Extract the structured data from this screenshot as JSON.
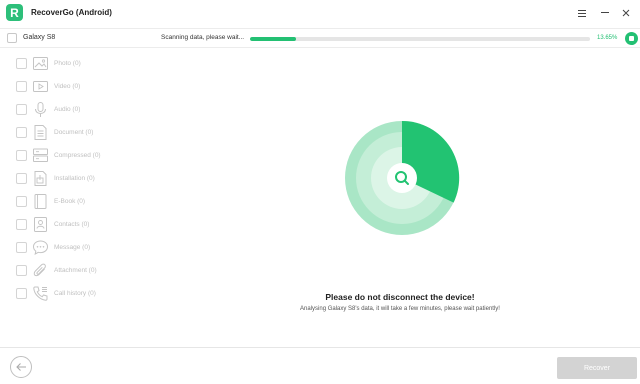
{
  "app": {
    "title": "RecoverGo (Android)",
    "logo_letter": "R",
    "brand_color": "#2dbf7a",
    "menu_icon": "hamburger-menu-icon",
    "minimize_icon": "minimize-icon",
    "close_icon": "close-icon"
  },
  "device": {
    "name": "Galaxy S8",
    "checked": false
  },
  "scan": {
    "status_text": "Scanning data, please wait...",
    "progress_percent": 13.65,
    "progress_label": "13.65%",
    "accent_color": "#23c073",
    "stop_icon": "stop-icon"
  },
  "categories": [
    {
      "icon": "photo-icon",
      "label": "Photo (0)"
    },
    {
      "icon": "video-icon",
      "label": "Video (0)"
    },
    {
      "icon": "audio-icon",
      "label": "Audio (0)"
    },
    {
      "icon": "document-icon",
      "label": "Document (0)"
    },
    {
      "icon": "compressed-icon",
      "label": "Compressed (0)"
    },
    {
      "icon": "installation-icon",
      "label": "Installation (0)"
    },
    {
      "icon": "ebook-icon",
      "label": "E-Book (0)"
    },
    {
      "icon": "contacts-icon",
      "label": "Contacts (0)"
    },
    {
      "icon": "message-icon",
      "label": "Message (0)"
    },
    {
      "icon": "attachment-icon",
      "label": "Attachment (0)"
    },
    {
      "icon": "call-history-icon",
      "label": "Call history (0)"
    }
  ],
  "center": {
    "radar_icon": "search-icon",
    "message_title": "Please do not disconnect the device!",
    "message_sub": "Analysing Galaxy S8's data, it will take a few minutes, please wait patiently!"
  },
  "footer": {
    "back_icon": "back-arrow-icon",
    "recover_label": "Recover"
  }
}
